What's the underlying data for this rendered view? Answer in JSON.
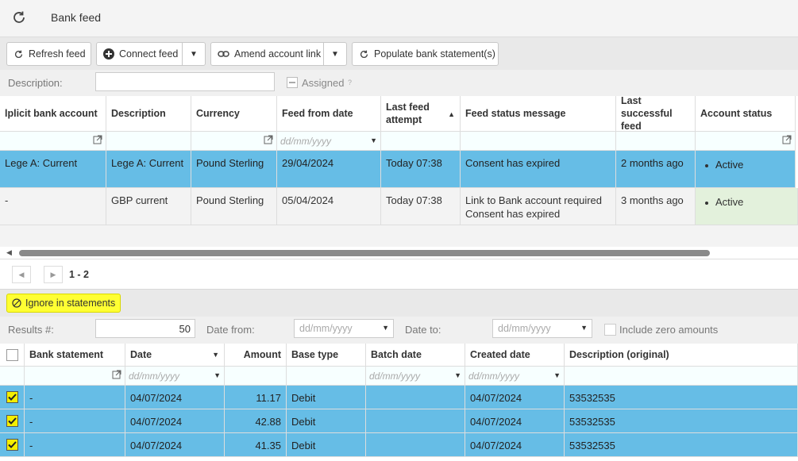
{
  "header": {
    "title": "Bank feed",
    "refresh_icon": "refresh-icon"
  },
  "toolbar": {
    "refresh_feed": "Refresh feed",
    "connect_feed": "Connect feed",
    "amend_account_link": "Amend account link",
    "populate_bank_statements": "Populate bank statement(s)"
  },
  "filters": {
    "description_label": "Description:",
    "description_value": "",
    "assigned_label": "Assigned",
    "assigned_help": "?"
  },
  "feeds_grid": {
    "columns": [
      "lplicit bank account",
      "Description",
      "Currency",
      "Feed from date",
      "Last feed attempt",
      "Feed status message",
      "Last successful feed",
      "Account status"
    ],
    "date_placeholder": "dd/mm/yyyy",
    "rows": [
      {
        "bank_account": "Lege A: Current",
        "description": "Lege A: Current",
        "currency": "Pound Sterling",
        "feed_from": "29/04/2024",
        "last_attempt": "Today 07:38",
        "status_msg_1": "Consent has expired",
        "status_msg_2": "",
        "last_success": "2 months ago",
        "account_status": "Active"
      },
      {
        "bank_account": "-",
        "description": "GBP current",
        "currency": "Pound Sterling",
        "feed_from": "05/04/2024",
        "last_attempt": "Today 07:38",
        "status_msg_1": "Link to Bank account required",
        "status_msg_2": "Consent has expired",
        "last_success": "3 months ago",
        "account_status": "Active"
      }
    ]
  },
  "pager": {
    "range": "1 - 2"
  },
  "statements": {
    "ignore_button": "Ignore in statements",
    "results_label": "Results #:",
    "results_value": "50",
    "date_from_label": "Date from:",
    "date_to_label": "Date to:",
    "date_placeholder": "dd/mm/yyyy",
    "include_zero_label": "Include zero amounts",
    "columns": [
      "Bank statement",
      "Date",
      "Amount",
      "Base type",
      "Batch date",
      "Created date",
      "Description (original)"
    ],
    "rows": [
      {
        "bank_statement": "-",
        "date": "04/07/2024",
        "amount": "11.17",
        "base_type": "Debit",
        "batch_date": "",
        "created_date": "04/07/2024",
        "description": "53532535"
      },
      {
        "bank_statement": "-",
        "date": "04/07/2024",
        "amount": "42.88",
        "base_type": "Debit",
        "batch_date": "",
        "created_date": "04/07/2024",
        "description": "53532535"
      },
      {
        "bank_statement": "-",
        "date": "04/07/2024",
        "amount": "41.35",
        "base_type": "Debit",
        "batch_date": "",
        "created_date": "04/07/2024",
        "description": "53532535"
      }
    ]
  },
  "colors": {
    "selected_row": "#66bde6",
    "highlight": "#ffff33",
    "active_status_bg": "#e3f1dc"
  }
}
